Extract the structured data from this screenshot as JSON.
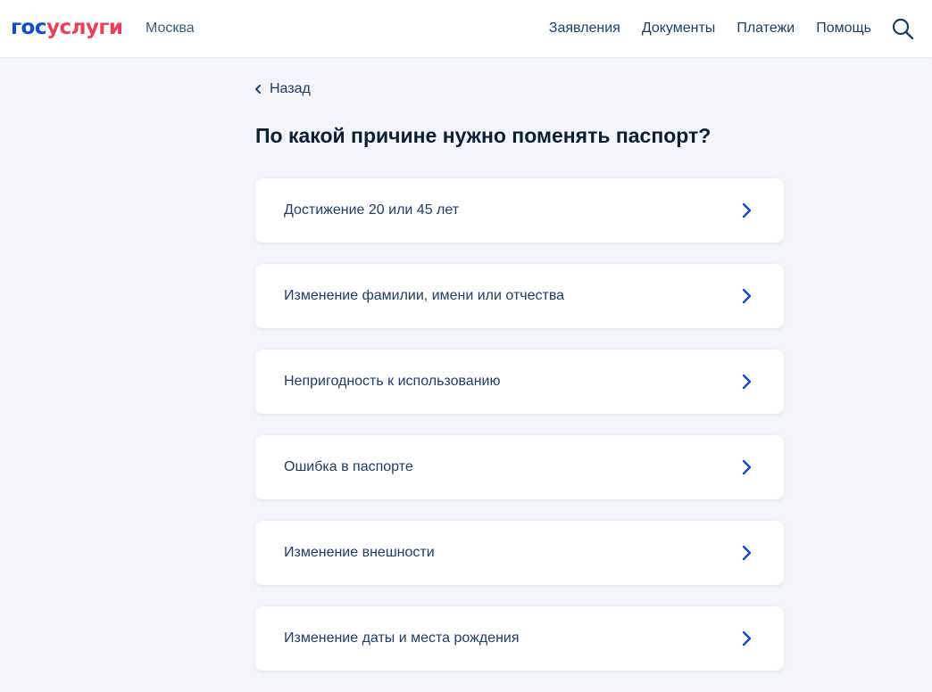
{
  "header": {
    "logo": {
      "part1": "гос",
      "part2": "услуги"
    },
    "city": "Москва",
    "nav": [
      "Заявления",
      "Документы",
      "Платежи",
      "Помощь"
    ]
  },
  "back_label": "Назад",
  "title": "По какой причине нужно поменять паспорт?",
  "options": [
    "Достижение 20 или 45 лет",
    "Изменение фамилии, имени или отчества",
    "Непригодность к использованию",
    "Ошибка в паспорте",
    "Изменение внешности",
    "Изменение даты и места рождения"
  ],
  "icons": {
    "search": "search-icon",
    "back": "chevron-left-icon",
    "option": "chevron-right-icon"
  },
  "colors": {
    "brand_blue": "#0d4cd3",
    "brand_red": "#ee3f58",
    "text_dark": "#0b1f33",
    "link": "#1d3f66",
    "background": "#f3f5fa"
  }
}
